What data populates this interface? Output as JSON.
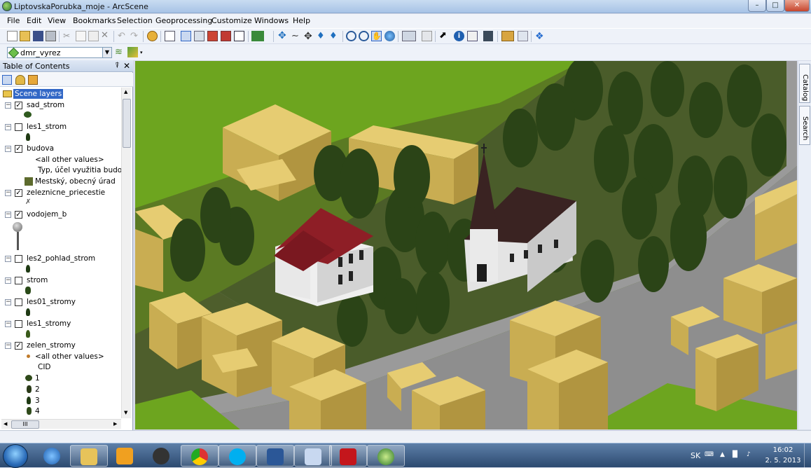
{
  "window": {
    "title": "LiptovskaPorubka_moje - ArcScene"
  },
  "menu": [
    "File",
    "Edit",
    "View",
    "Bookmarks",
    "Selection",
    "Geoprocessing",
    "Customize",
    "Windows",
    "Help"
  ],
  "layer_dropdown": {
    "value": "dmr_vyrez"
  },
  "toc": {
    "title": "Table of Contents",
    "pin_glyph": "⍒",
    "close_glyph": "✕",
    "root": "Scene layers",
    "layers": [
      {
        "name": "sad_strom",
        "checked": true
      },
      {
        "name": "les1_strom",
        "checked": false
      },
      {
        "name": "budova",
        "checked": true
      },
      {
        "name": "zeleznicne_priecestie",
        "checked": true
      },
      {
        "name": "vodojem_b",
        "checked": true
      },
      {
        "name": "les2_pohlad_strom",
        "checked": false
      },
      {
        "name": "strom",
        "checked": false
      },
      {
        "name": "les01_stromy",
        "checked": false
      },
      {
        "name": "les1_stromy",
        "checked": false
      },
      {
        "name": "zelen_stromy",
        "checked": true
      }
    ],
    "budova_legend": [
      "<all other values>",
      "Typ, účel využitia budovy",
      "Mestský, obecný úrad"
    ],
    "zelen_legend": [
      "<all other values>",
      "CID",
      "1",
      "2",
      "3",
      "4"
    ],
    "hscroll_glyph": "III"
  },
  "right_dock": {
    "catalog": "Catalog",
    "search": "Search"
  },
  "taskbar": {
    "lang": "SK",
    "time": "16:02",
    "date": "2. 5. 2013"
  },
  "colors": {
    "terrain": "#5b7a23",
    "grass": "#6da51f",
    "road": "#9a9a9a",
    "block": "#d3b75e",
    "roof": "#8e1e26",
    "church_roof": "#3a2322",
    "tree": "#2f4a1a"
  }
}
